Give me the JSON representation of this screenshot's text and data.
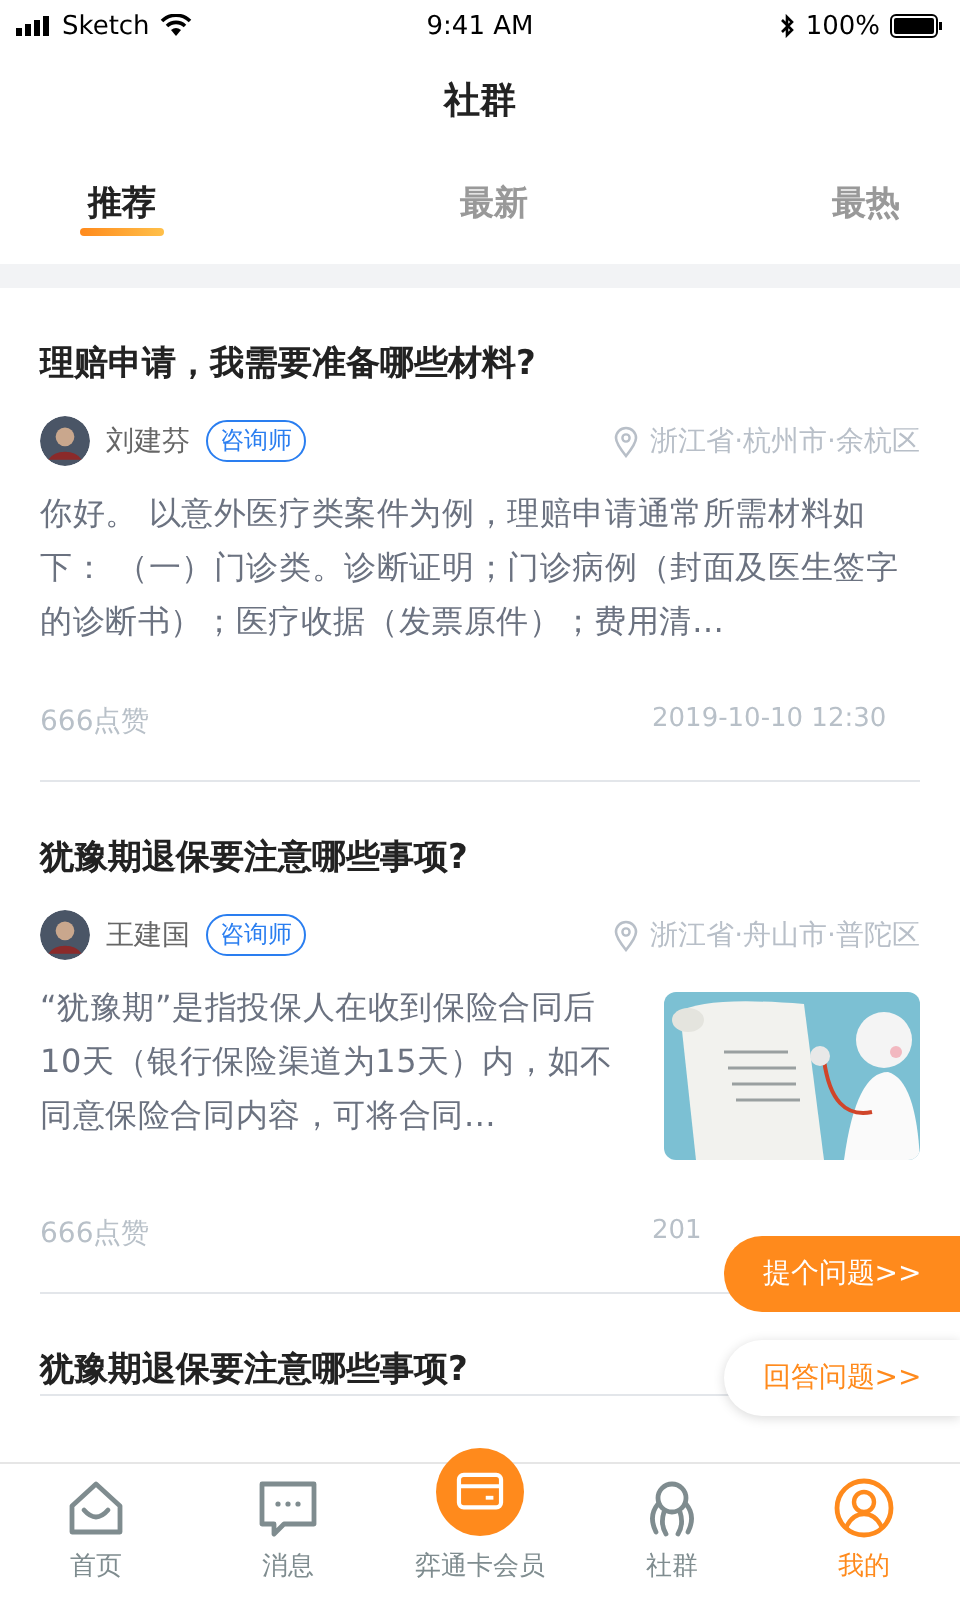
{
  "status_bar": {
    "carrier": "Sketch",
    "time": "9:41 AM",
    "battery": "100%"
  },
  "title": "社群",
  "tabs": [
    {
      "label": "推荐",
      "selected": true
    },
    {
      "label": "最新",
      "selected": false
    },
    {
      "label": "最热",
      "selected": false
    }
  ],
  "posts": [
    {
      "title": "理赔申请，我需要准备哪些材料?",
      "author": "刘建芬",
      "role": "咨询师",
      "location": "浙江省·杭州市·余杭区",
      "body": "你好。 以意外医疗类案件为例，理赔申请通常所需材料如下：  （一）门诊类。诊断证明；门诊病例（封面及医生签字的诊断书）；医疗收据（发票原件）；费用清…",
      "likes": "666点赞",
      "date": "2019-10-10 12:30"
    },
    {
      "title": "犹豫期退保要注意哪些事项?",
      "author": "王建国",
      "role": "咨询师",
      "location": "浙江省·舟山市·普陀区",
      "body": "“犹豫期”是指投保人在收到保险合同后10天（银行保险渠道为15天）内，如不同意保险合同内容，可将合同…",
      "likes": "666点赞",
      "date": "201"
    },
    {
      "title": "犹豫期退保要注意哪些事项?"
    }
  ],
  "floating_buttons": [
    {
      "label": "提个问题>>",
      "kind": "primary"
    },
    {
      "label": "回答问题>>",
      "kind": "secondary"
    }
  ],
  "bottom_nav": [
    {
      "label": "首页",
      "selected": false
    },
    {
      "label": "消息",
      "selected": false
    },
    {
      "label": "弈通卡会员",
      "selected": false
    },
    {
      "label": "社群",
      "selected": false
    },
    {
      "label": "我的",
      "selected": true
    }
  ]
}
